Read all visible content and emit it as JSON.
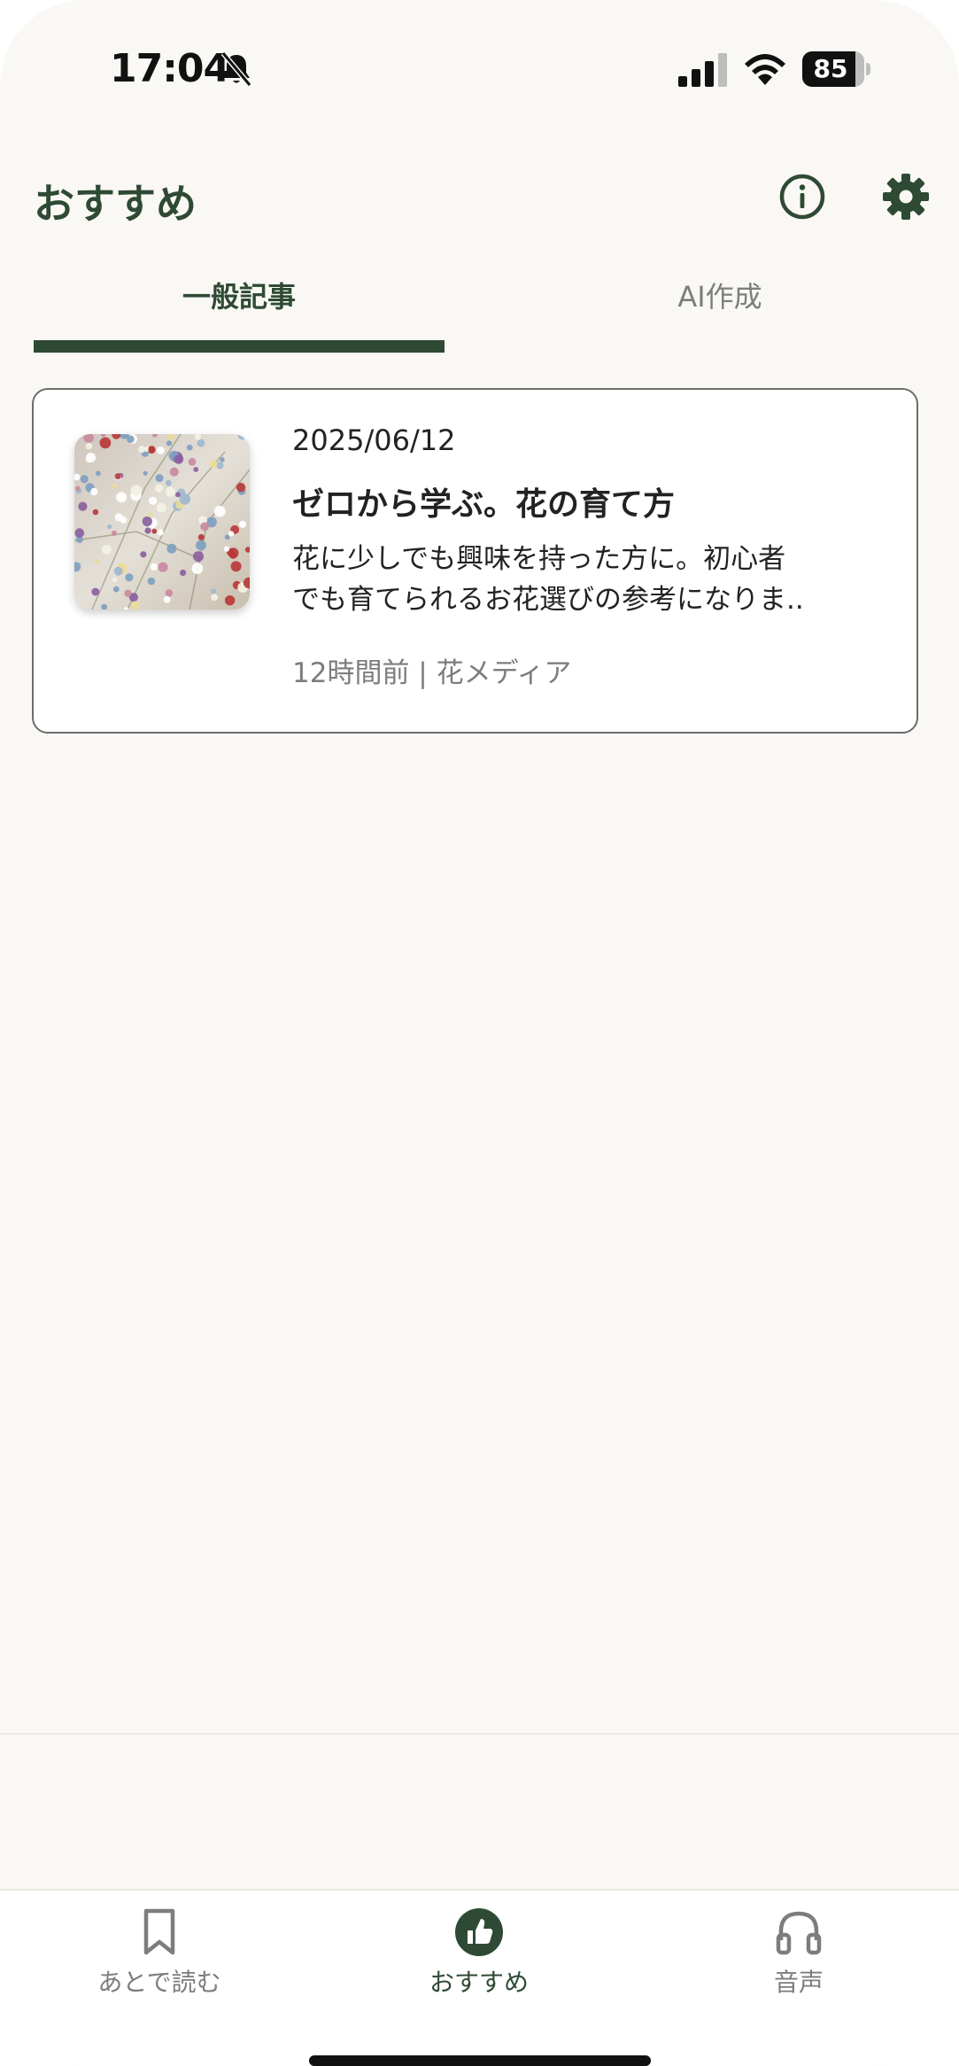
{
  "status_bar": {
    "time": "17:04",
    "battery_level": "85",
    "battery_fraction": 0.85,
    "icons": [
      "bell-off-icon",
      "signal-icon",
      "wifi-icon",
      "battery-icon"
    ]
  },
  "header": {
    "title": "おすすめ",
    "icons": [
      "info-icon",
      "gear-icon"
    ]
  },
  "tabs": [
    {
      "label": "一般記事",
      "selected": true
    },
    {
      "label": "AI作成",
      "selected": false
    }
  ],
  "articles": [
    {
      "date": "2025/06/12",
      "title": "ゼロから学ぶ。花の育て方",
      "excerpt_lines": [
        "花に少しでも興味を持った方に。初心者",
        "でも育てられるお花選びの参考になりま.."
      ],
      "meta": "12時間前 | 花メディア"
    }
  ],
  "bottom_nav": [
    {
      "label": "あとで読む",
      "icon": "bookmark-icon",
      "selected": false
    },
    {
      "label": "おすすめ",
      "icon": "thumbs-up-icon",
      "selected": true
    },
    {
      "label": "音声",
      "icon": "headphones-icon",
      "selected": false
    }
  ],
  "colors": {
    "accent": "#2f4a34",
    "background": "#faf8f4",
    "muted_text": "#7d7d7d"
  }
}
